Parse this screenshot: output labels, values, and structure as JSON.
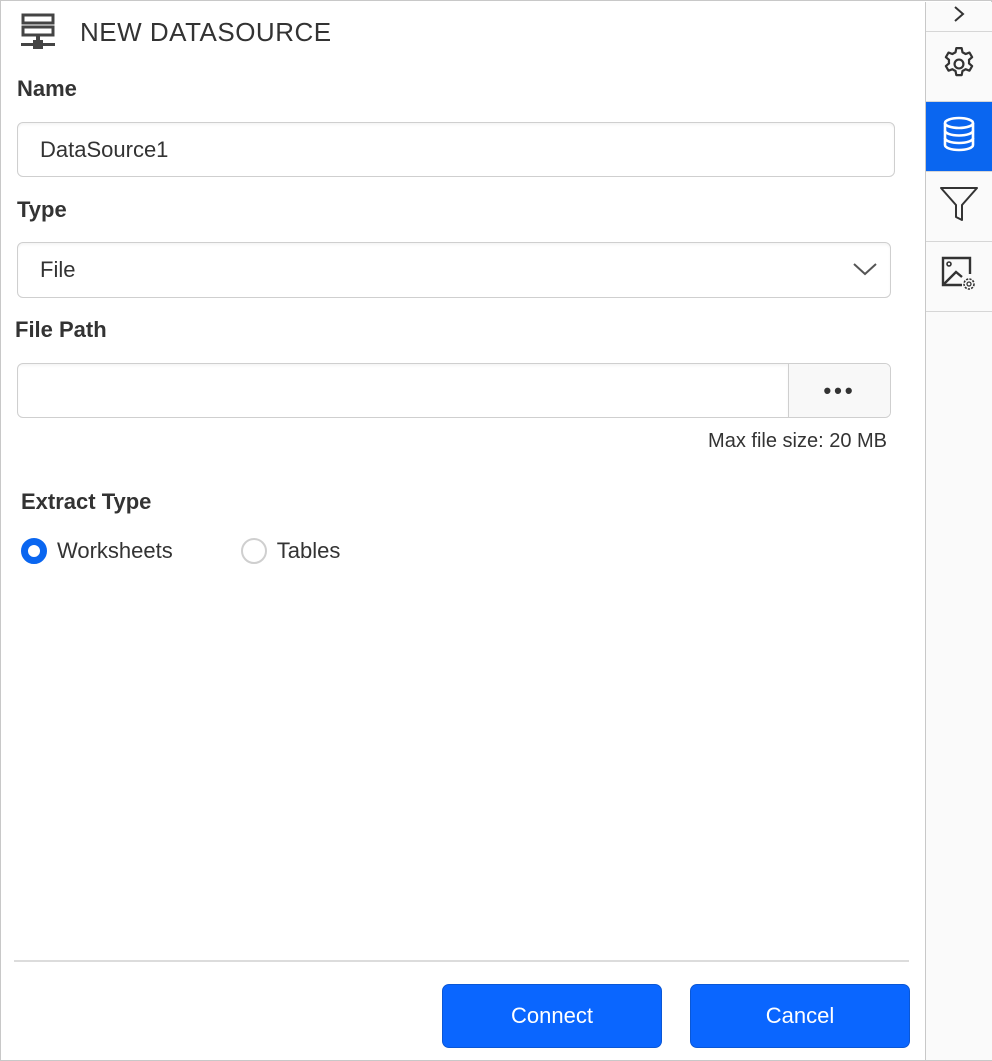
{
  "header": {
    "title": "NEW DATASOURCE",
    "icon": "datasource-server-icon"
  },
  "form": {
    "name": {
      "label": "Name",
      "value": "DataSource1",
      "placeholder": ""
    },
    "type": {
      "label": "Type",
      "selected": "File",
      "icon": "chevron-down-icon"
    },
    "file_path": {
      "label": "File Path",
      "value": "",
      "placeholder": "",
      "browse_label": "•••",
      "hint": "Max file size: 20 MB"
    },
    "extract_type": {
      "label": "Extract Type",
      "options": [
        {
          "label": "Worksheets",
          "checked": true
        },
        {
          "label": "Tables",
          "checked": false
        }
      ]
    }
  },
  "footer": {
    "connect_label": "Connect",
    "cancel_label": "Cancel"
  },
  "sidebar": {
    "items": [
      {
        "name": "collapse",
        "icon": "chevron-right-icon",
        "active": false
      },
      {
        "name": "properties",
        "icon": "gear-icon",
        "active": false
      },
      {
        "name": "data",
        "icon": "database-icon",
        "active": true
      },
      {
        "name": "filter",
        "icon": "filter-icon",
        "active": false
      },
      {
        "name": "image-settings",
        "icon": "image-settings-icon",
        "active": false
      }
    ]
  },
  "colors": {
    "accent": "#0a66f0",
    "button": "#0a66ff",
    "text": "#333333",
    "border": "#cfcfcf"
  }
}
